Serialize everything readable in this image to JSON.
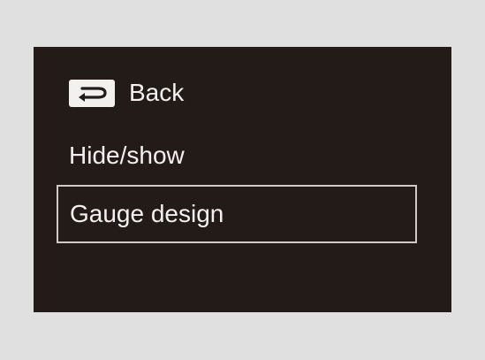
{
  "menu": {
    "items": [
      {
        "label": "Back",
        "icon": "back-arrow-icon"
      },
      {
        "label": "Hide/show"
      },
      {
        "label": "Gauge design",
        "selected": true
      }
    ]
  },
  "colors": {
    "outer_background": "#dfe0df",
    "screen_background": "#231b18",
    "text": "#f3f1ef",
    "selection_border": "#cfcac6"
  }
}
